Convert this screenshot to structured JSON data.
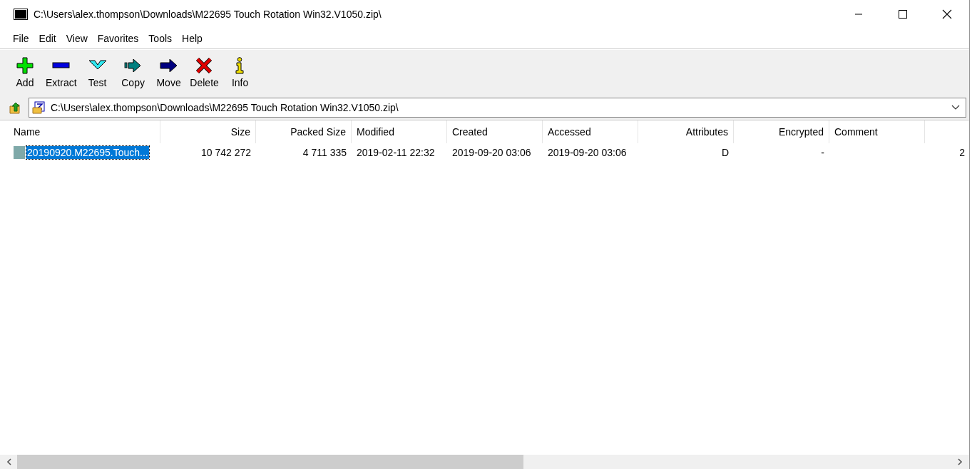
{
  "window": {
    "title": "C:\\Users\\alex.thompson\\Downloads\\M22695 Touch Rotation Win32.V1050.zip\\"
  },
  "menu": [
    "File",
    "Edit",
    "View",
    "Favorites",
    "Tools",
    "Help"
  ],
  "toolbar": [
    {
      "kind": "add",
      "label": "Add"
    },
    {
      "kind": "extract",
      "label": "Extract"
    },
    {
      "kind": "test",
      "label": "Test"
    },
    {
      "kind": "copy",
      "label": "Copy"
    },
    {
      "kind": "move",
      "label": "Move"
    },
    {
      "kind": "delete",
      "label": "Delete"
    },
    {
      "kind": "info",
      "label": "Info"
    }
  ],
  "address": {
    "value": "C:\\Users\\alex.thompson\\Downloads\\M22695 Touch Rotation Win32.V1050.zip\\"
  },
  "table": {
    "columns": [
      "Name",
      "Size",
      "Packed Size",
      "Modified",
      "Created",
      "Accessed",
      "Attributes",
      "Encrypted",
      "Comment"
    ],
    "rows": [
      {
        "selected": true,
        "cells": [
          "20190920.M22695.Touch...",
          "10 742 272",
          "4 711 335",
          "2019-02-11 22:32",
          "2019-09-20 03:06",
          "2019-09-20 03:06",
          "D",
          "-",
          "",
          "2"
        ]
      }
    ]
  }
}
